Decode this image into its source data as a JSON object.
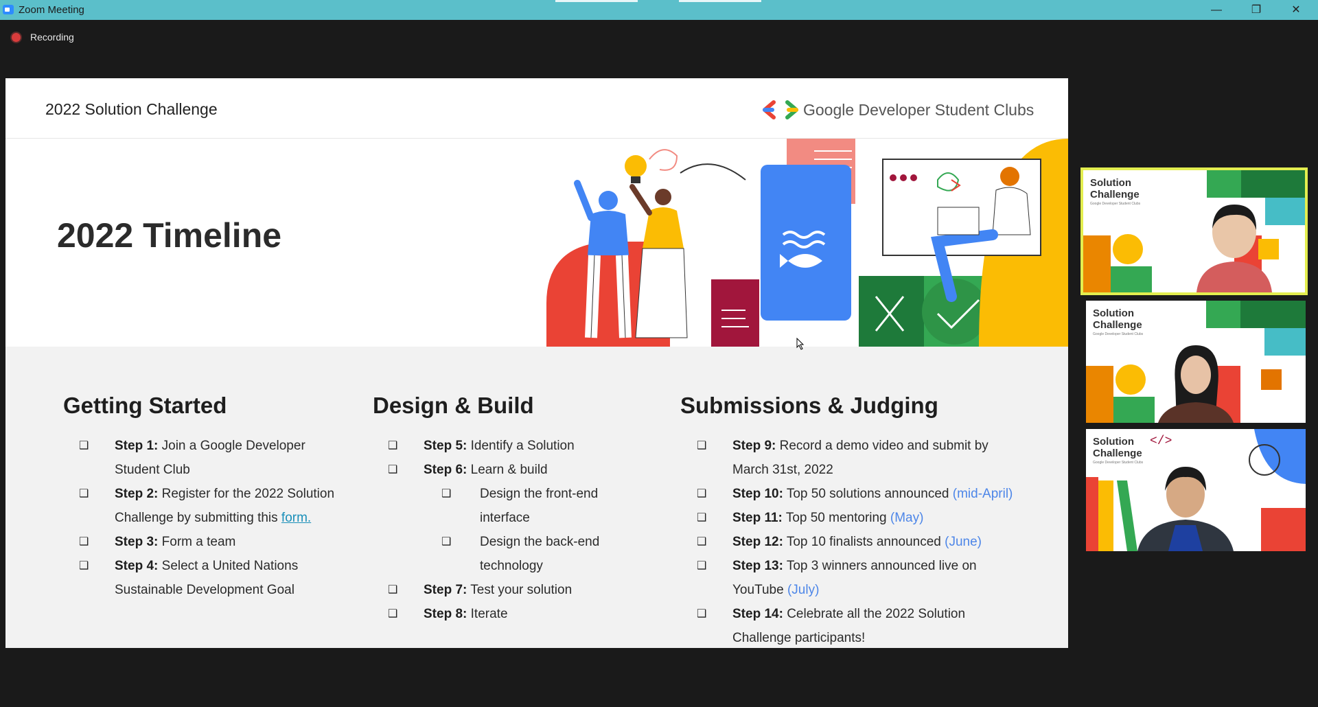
{
  "window": {
    "title": "Zoom Meeting",
    "minimize_icon": "minimize-icon",
    "restore_icon": "restore-icon",
    "close_icon": "close-icon"
  },
  "recording": {
    "label": "Recording"
  },
  "slide": {
    "header_title": "2022 Solution Challenge",
    "brand": "Google Developer Student Clubs",
    "title": "2022 Timeline",
    "columns": [
      {
        "heading": "Getting Started",
        "items": [
          {
            "step": "Step 1:",
            "text": "Join a Google Developer",
            "text2": "Student Club"
          },
          {
            "step": "Step 2:",
            "text": "Register for the 2022 Solution",
            "text2": "Challenge by submitting this ",
            "link": "form."
          },
          {
            "step": "Step 3:",
            "text": "Form a team"
          },
          {
            "step": "Step 4:",
            "text": "Select a United Nations",
            "text2": "Sustainable Development Goal"
          }
        ]
      },
      {
        "heading": "Design & Build",
        "items": [
          {
            "step": "Step 5:",
            "text": "Identify a Solution"
          },
          {
            "step": "Step 6:",
            "text": "Learn & build"
          },
          {
            "sub": "Design the front-end",
            "sub2": "interface"
          },
          {
            "sub": "Design the back-end",
            "sub2": "technology"
          },
          {
            "step": "Step 7:",
            "text": "Test your solution"
          },
          {
            "step": "Step 8:",
            "text": "Iterate"
          }
        ]
      },
      {
        "heading": "Submissions & Judging",
        "items": [
          {
            "step": "Step 9:",
            "text": "Record a demo video and submit by",
            "text2": "March 31st, 2022"
          },
          {
            "step": "Step 10:",
            "text": "Top 50 solutions announced ",
            "note": "(mid-April)"
          },
          {
            "step": "Step 11:",
            "text": "Top 50 mentoring ",
            "note": "(May)"
          },
          {
            "step": "Step 12:",
            "text": "Top 10 finalists announced ",
            "note": "(June)"
          },
          {
            "step": "Step 13:",
            "text": "Top 3 winners announced live on",
            "text2": "YouTube ",
            "note2": "(July)"
          },
          {
            "step": "Step 14:",
            "text": "Celebrate all the 2022 Solution",
            "text2": "Challenge participants!"
          }
        ]
      }
    ],
    "checkbox_glyph": "❑"
  },
  "participants": [
    {
      "background_label": "Solution\nChallenge",
      "tag": "Google Developer Student Clubs",
      "active": true
    },
    {
      "background_label": "Solution\nChallenge",
      "tag": "Google Developer Student Clubs",
      "active": false
    },
    {
      "background_label": "Solution\nChallenge",
      "tag": "Google Developer Student Clubs",
      "active": false
    }
  ],
  "colors": {
    "titlebar": "#5bbfca",
    "google_blue": "#4285f4",
    "google_red": "#ea4335",
    "google_yellow": "#fbbc04",
    "google_green": "#34a853",
    "active_speaker": "#e3ee4f"
  }
}
